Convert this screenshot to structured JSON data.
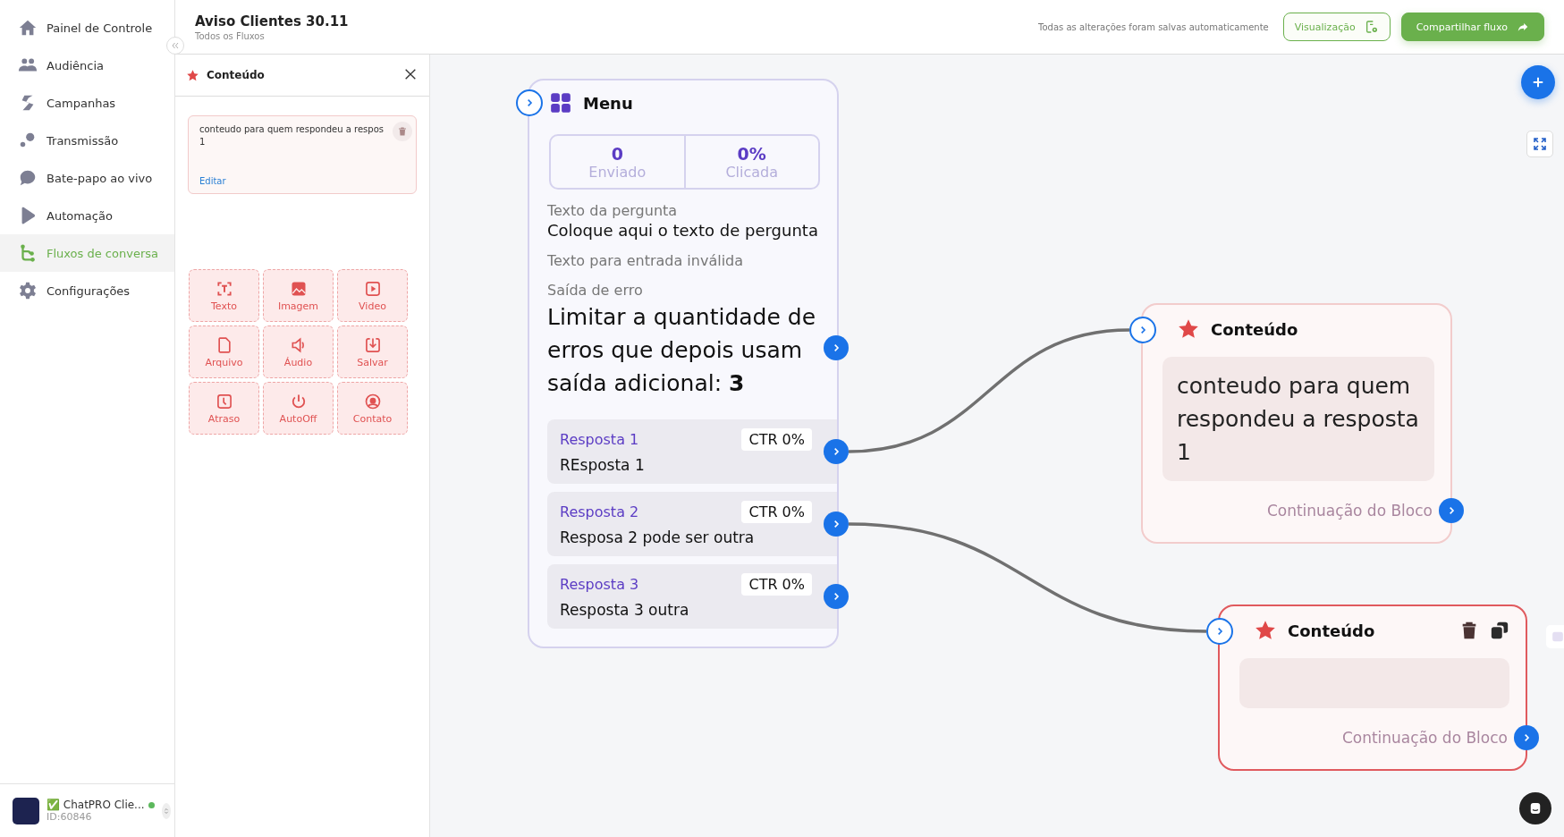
{
  "sidebar": {
    "items": [
      {
        "label": "Painel de Controle",
        "kind": "home",
        "selected": false
      },
      {
        "label": "Audiência",
        "kind": "people",
        "selected": false
      },
      {
        "label": "Campanhas",
        "kind": "bolt",
        "selected": false
      },
      {
        "label": "Transmissão",
        "kind": "dots",
        "selected": false
      },
      {
        "label": "Bate-papo ao vivo",
        "kind": "chat",
        "selected": false
      },
      {
        "label": "Automação",
        "kind": "play",
        "selected": false
      },
      {
        "label": "Fluxos de conversa",
        "kind": "flow",
        "selected": true
      },
      {
        "label": "Configurações",
        "kind": "gear",
        "selected": false
      }
    ],
    "account": {
      "badge": "✅",
      "name": "ChatPRO Clie...",
      "id": "ID:60846",
      "online": true
    }
  },
  "header": {
    "title": "Aviso Clientes 30.11",
    "breadcrumb": "Todos os Fluxos",
    "save_status": "Todas as alterações foram salvas automaticamente",
    "buttons": [
      {
        "label": "Visualização",
        "kind": "outline"
      },
      {
        "label": "Compartilhar fluxo",
        "kind": "primary"
      }
    ]
  },
  "panel": {
    "title": "Conteúdo",
    "message": {
      "lines": [
        "conteudo para quem respondeu a respos",
        "1"
      ],
      "edit": "Editar"
    },
    "tools": [
      {
        "label": "Texto",
        "kind": "text"
      },
      {
        "label": "Imagem",
        "kind": "image"
      },
      {
        "label": "Video",
        "kind": "video"
      },
      {
        "label": "Arquivo",
        "kind": "file"
      },
      {
        "label": "Áudio",
        "kind": "audio"
      },
      {
        "label": "Salvar",
        "kind": "save"
      },
      {
        "label": "Atraso",
        "kind": "clock"
      },
      {
        "label": "AutoOff",
        "kind": "power"
      },
      {
        "label": "Contato",
        "kind": "contact"
      }
    ]
  },
  "canvas": {
    "nodes": [
      {
        "kind": "menu",
        "title": "Menu",
        "stats": [
          {
            "value": "0",
            "label": "Enviado"
          },
          {
            "value": "0%",
            "label": "Clicada"
          }
        ],
        "fields": [
          {
            "label": "Texto da pergunta",
            "value": "Coloque aqui o texto de pergunta"
          },
          {
            "label": "Texto para entrada inválida"
          },
          {
            "label": "Saída de erro",
            "value": "Limitar a quantidade de erros que depois usam saída adicional: **3**",
            "kind": "large"
          }
        ],
        "responses": [
          {
            "title": "Resposta 1",
            "ctr": "CTR 0%",
            "text": "REsposta 1"
          },
          {
            "title": "Resposta 2",
            "ctr": "CTR 0%",
            "text": "Resposa 2 pode ser outra"
          },
          {
            "title": "Resposta 3",
            "ctr": "CTR 0%",
            "text": "Resposta 3 outra"
          }
        ]
      },
      {
        "kind": "content",
        "title": "Conteúdo",
        "selected": false,
        "text": "conteudo para quem respondeu a resposta 1",
        "continuation": "Continuação do Bloco"
      },
      {
        "kind": "content",
        "title": "Conteúdo",
        "selected": true,
        "continuation": "Continuação do Bloco"
      }
    ]
  }
}
